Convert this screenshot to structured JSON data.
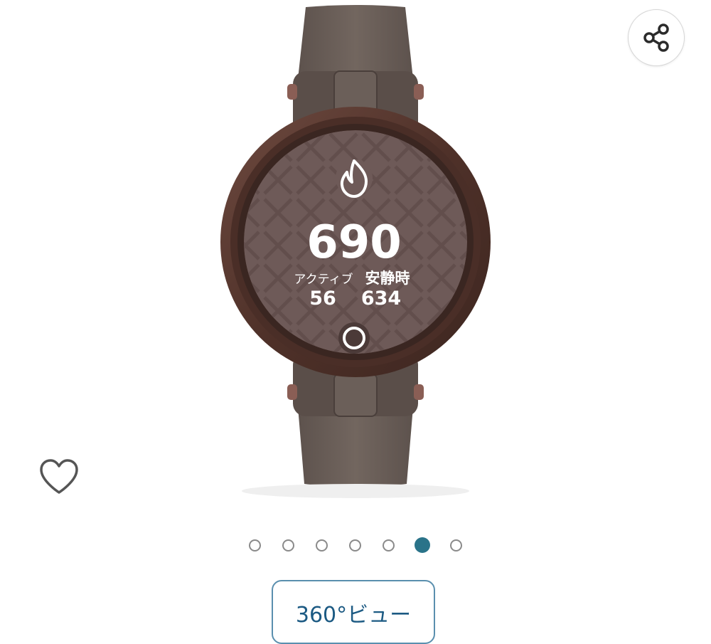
{
  "watch_face": {
    "calories_total": "690",
    "active_label": "アクティブ",
    "active_value": "56",
    "resting_label": "安静時",
    "resting_value": "634"
  },
  "carousel": {
    "dot_count": 7,
    "active_index": 5
  },
  "view360": {
    "label": "360°ビュー"
  },
  "colors": {
    "accent": "#2a7389",
    "button_text": "#1c5a83",
    "band": "#6b5f59",
    "bezel": "#5b3c35",
    "face": "#6e5a58"
  },
  "icons": {
    "share": "share-icon",
    "wishlist": "heart-outline-icon",
    "calories": "flame-icon"
  }
}
